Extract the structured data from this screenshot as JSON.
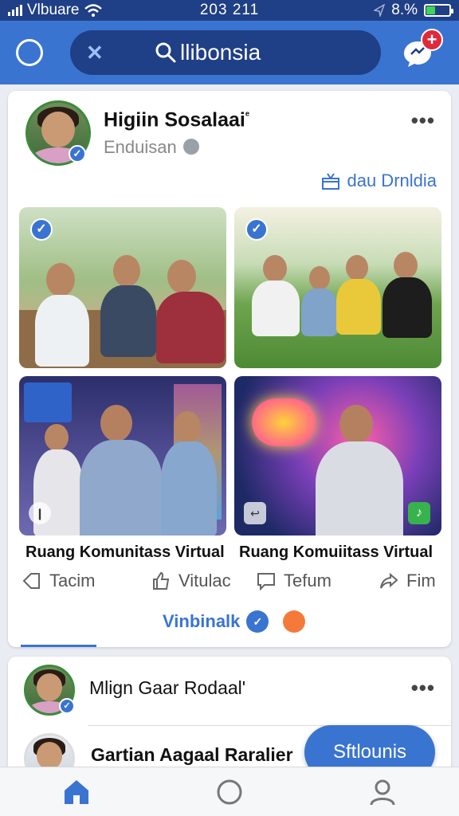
{
  "status_bar": {
    "carrier": "Vlbuare",
    "time": "203 211",
    "battery_text": "8.%"
  },
  "header": {
    "search_text": "llibonsia",
    "search_prefix_icon": "close-x-icon",
    "badge_text": "+"
  },
  "post": {
    "author": "Higiin Sosalaai",
    "author_mark": "ᵉ",
    "subtitle": "Enduisan",
    "link_text": "dau Drnldia",
    "images": [
      {
        "name": "meeting-table",
        "corner_icon": ""
      },
      {
        "name": "park-group",
        "corner_icon": ""
      },
      {
        "name": "gaming-room",
        "corner_icon": ""
      },
      {
        "name": "music-stage",
        "corner_icon": ""
      }
    ],
    "captions": [
      "Ruang Komunitass Virtual",
      "Ruang Komuiitass Virtual"
    ],
    "actions": [
      {
        "label": "Tacim",
        "icon": "tag-icon"
      },
      {
        "label": "Vitulac",
        "icon": "thumbs-up-icon"
      },
      {
        "label": "Tefum",
        "icon": "comment-icon"
      },
      {
        "label": "Fim",
        "icon": "share-icon"
      }
    ],
    "reaction_label": "Vinbinalk"
  },
  "feed": {
    "second_author": "Mlign Gaar Rodaal'",
    "third_author": "Gartian Aagaal Raralier"
  },
  "fab": {
    "label": "Sftlounis"
  },
  "colors": {
    "brand": "#3a74d1",
    "status_bar": "#1f3f86",
    "alert": "#e0293a"
  }
}
